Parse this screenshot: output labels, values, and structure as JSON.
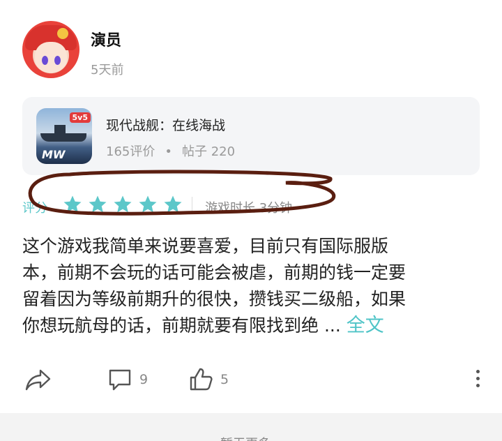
{
  "post": {
    "username": "演员",
    "time": "5天前"
  },
  "game": {
    "title": "现代战舰：在线海战",
    "reviews": "165评价",
    "dot": "•",
    "posts": "帖子 220",
    "icon_badge": "5v5",
    "icon_logo": "MW"
  },
  "rating": {
    "label": "评分",
    "stars": 5,
    "max_stars": 5,
    "star_color": "#5cc7c9",
    "playtime": "游戏时长 3分钟"
  },
  "review": {
    "lines": [
      "这个游戏我简单来说要喜爱，目前只有国际服版",
      "本，前期不会玩的话可能会被虐，前期的钱一定要",
      "留着因为等级前期升的很快，攒钱买二级船，如果",
      "你想玩航母的话，前期就要有限找到绝 ..."
    ],
    "more": "全文"
  },
  "actions": {
    "share_icon": "share-icon",
    "comment_icon": "comment-icon",
    "comments": "9",
    "like_icon": "thumbs-up-icon",
    "likes": "5",
    "more_icon": "more-vertical-icon"
  },
  "footer": {
    "text": "暂无更多"
  },
  "accent_color": "#5cc7c9",
  "annotation_color": "#5a1e10"
}
